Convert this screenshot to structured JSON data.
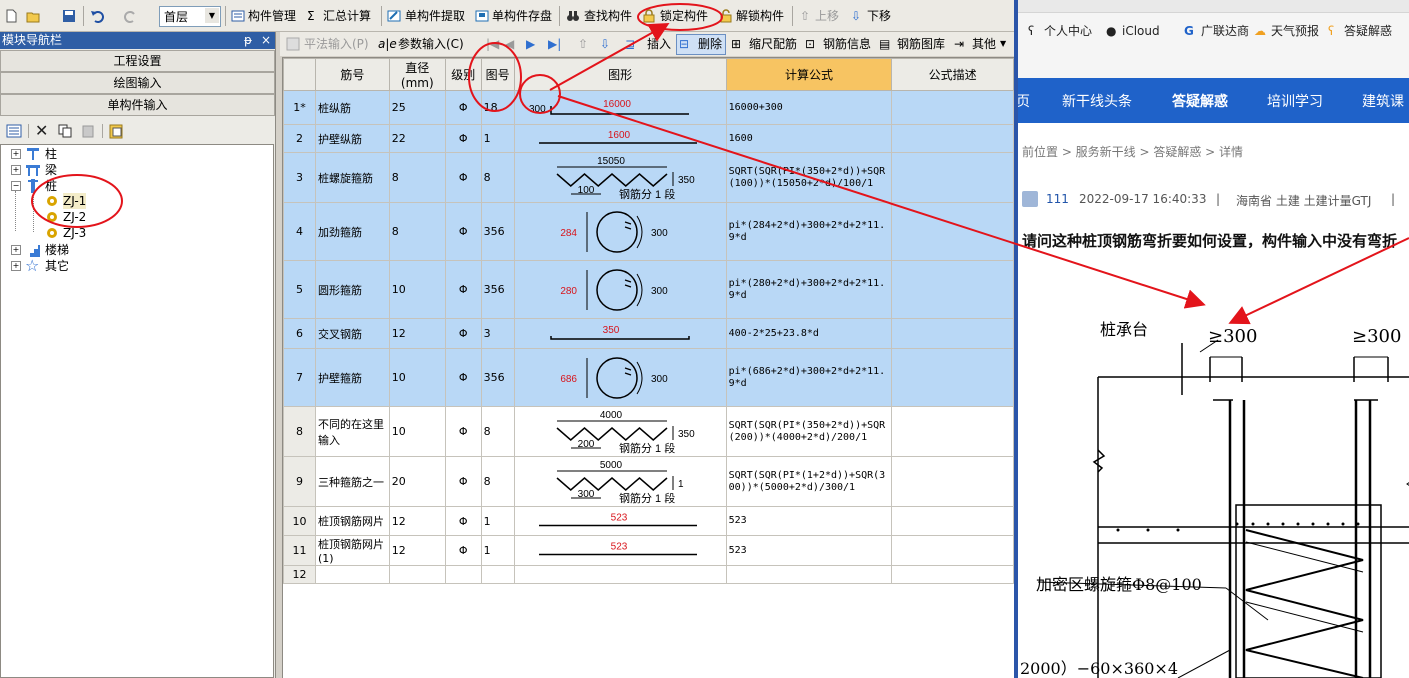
{
  "toolbar": {
    "floor": "首层",
    "component_manage": "构件管理",
    "sum_calc": "汇总计算",
    "single_extract": "单构件提取",
    "single_save": "单构件存盘",
    "find_component": "查找构件",
    "lock_component": "锁定构件",
    "unlock_component": "解锁构件",
    "move_up": "上移",
    "move_down": "下移"
  },
  "nav": {
    "title": "模块导航栏",
    "pin": "ᵽ",
    "close": "×",
    "buttons": [
      "工程设置",
      "绘图输入",
      "单构件输入"
    ],
    "tree": {
      "col": "柱",
      "beam": "梁",
      "pile": "桩",
      "pile_items": [
        "ZJ-1",
        "ZJ-2",
        "ZJ-3"
      ],
      "stair": "楼梯",
      "other": "其它"
    }
  },
  "gridtools": {
    "plain_input": "平法输入(P)",
    "param_input": "参数输入(C)",
    "insert": "插入",
    "delete": "删除",
    "scale_rebar": "缩尺配筋",
    "rebar_info": "钢筋信息",
    "rebar_lib": "钢筋图库",
    "other": "其他"
  },
  "table": {
    "headers": [
      "筋号",
      "直径(mm)",
      "级别",
      "图号",
      "图形",
      "计算公式",
      "公式描述"
    ],
    "segment_label": "钢筋分 1 段",
    "rows": [
      {
        "no": "1*",
        "name": "桩纵筋",
        "dia": "25",
        "grade": "Φ",
        "fig": "18",
        "formula": "16000+300",
        "shape_left": "300",
        "shape_len": "16000"
      },
      {
        "no": "2",
        "name": "护壁纵筋",
        "dia": "22",
        "grade": "Φ",
        "fig": "1",
        "formula": "1600",
        "shape_len": "1600"
      },
      {
        "no": "3",
        "name": "桩螺旋箍筋",
        "dia": "8",
        "grade": "Φ",
        "fig": "8",
        "formula": "SQRT(SQR(PI*(350+2*d))+SQR(100))*(15050+2*d)/100/1",
        "shape_top": "15050",
        "shape_right": "350",
        "shape_bottom": "100"
      },
      {
        "no": "4",
        "name": "加劲箍筋",
        "dia": "8",
        "grade": "Φ",
        "fig": "356",
        "formula": "pi*(284+2*d)+300+2*d+2*11.9*d",
        "shape_left": "284",
        "shape_right": "300"
      },
      {
        "no": "5",
        "name": "圆形箍筋",
        "dia": "10",
        "grade": "Φ",
        "fig": "356",
        "formula": "pi*(280+2*d)+300+2*d+2*11.9*d",
        "shape_left": "280",
        "shape_right": "300"
      },
      {
        "no": "6",
        "name": "交叉钢筋",
        "dia": "12",
        "grade": "Φ",
        "fig": "3",
        "formula": "400-2*25+23.8*d",
        "shape_len": "350"
      },
      {
        "no": "7",
        "name": "护壁箍筋",
        "dia": "10",
        "grade": "Φ",
        "fig": "356",
        "formula": "pi*(686+2*d)+300+2*d+2*11.9*d",
        "shape_left": "686",
        "shape_right": "300"
      },
      {
        "no": "8",
        "name": "不同的在这里输入",
        "dia": "10",
        "grade": "Φ",
        "fig": "8",
        "formula": "SQRT(SQR(PI*(350+2*d))+SQR(200))*(4000+2*d)/200/1",
        "shape_top": "4000",
        "shape_right": "350",
        "shape_bottom": "200"
      },
      {
        "no": "9",
        "name": "三种箍筋之一",
        "dia": "20",
        "grade": "Φ",
        "fig": "8",
        "formula": "SQRT(SQR(PI*(1+2*d))+SQR(300))*(5000+2*d)/300/1",
        "shape_top": "5000",
        "shape_right": "1",
        "shape_bottom": "300"
      },
      {
        "no": "10",
        "name": "桩顶钢筋网片",
        "dia": "12",
        "grade": "Φ",
        "fig": "1",
        "formula": "523",
        "shape_len": "523"
      },
      {
        "no": "11",
        "name": "桩顶钢筋网片(1)",
        "dia": "12",
        "grade": "Φ",
        "fig": "1",
        "formula": "523",
        "shape_len": "523"
      },
      {
        "no": "12",
        "name": "",
        "dia": "",
        "grade": "",
        "fig": "",
        "formula": ""
      }
    ]
  },
  "browser": {
    "bookmarks": [
      "个人中心",
      "iCloud",
      "广联达商",
      "天气预报",
      "答疑解惑"
    ],
    "site_nav": [
      "页",
      "新干线头条",
      "答疑解惑",
      "培训学习",
      "建筑课"
    ],
    "breadcrumb": "前位置 > 服务新干线 > 答疑解惑 > 详情",
    "meta": {
      "user": "111",
      "datetime": "2022-09-17 16:40:33",
      "sep1": "|",
      "tags": "海南省  土建 土建计量GTJ",
      "sep2": "|"
    },
    "question_title": "请问这种桩顶钢筋弯折要如何设置，构件输入中没有弯折",
    "drawing": {
      "cap_label": "桩承台",
      "dim1": "≥300",
      "dim2": "≥300",
      "spiral_label": "加密区螺旋箍Φ8@100",
      "bottom_text": "2000）−60×360×4"
    }
  },
  "colors": {
    "accent_nav": "#2f5ea5",
    "site_nav": "#1f62c9",
    "selected_row": "#b9d8f6",
    "formula_header": "#f7c462",
    "annotation": "#e3141b",
    "dim_red": "#d8141b"
  }
}
